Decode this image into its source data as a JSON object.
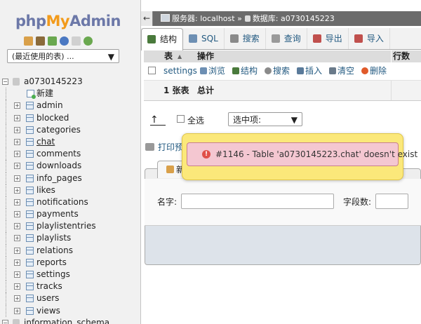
{
  "app": {
    "logo_php": "php",
    "logo_my": "My",
    "logo_admin": "Admin"
  },
  "left_panel": {
    "recent_select": "(最近使用的表) ...",
    "icons": [
      "home-icon",
      "exit-icon",
      "sql-query-icon",
      "help-icon",
      "docs-icon",
      "settings-icon"
    ],
    "database": "a0730145223",
    "new_item": "新建",
    "tables": [
      "admin",
      "blocked",
      "categories",
      "chat",
      "comments",
      "downloads",
      "info_pages",
      "likes",
      "notifications",
      "payments",
      "playlistentries",
      "playlists",
      "relations",
      "reports",
      "settings",
      "tracks",
      "users",
      "views"
    ],
    "next_database": "information_schema"
  },
  "breadcrumb": {
    "back": "←",
    "server": "服务器: localhost »",
    "database": "数据库: a0730145223"
  },
  "tabs": [
    {
      "label": "结构",
      "icon": "structure-icon",
      "color": "#4a7a3c"
    },
    {
      "label": "SQL",
      "icon": "sql-icon",
      "color": "#6d8fb3"
    },
    {
      "label": "搜索",
      "icon": "search-icon",
      "color": "#8a8a8a"
    },
    {
      "label": "查询",
      "icon": "query-icon",
      "color": "#9a9a9a"
    },
    {
      "label": "导出",
      "icon": "export-icon",
      "color": "#c0504d"
    },
    {
      "label": "导入",
      "icon": "import-icon",
      "color": "#c0504d"
    }
  ],
  "table_list": {
    "col_table": "表",
    "col_sort": "▲",
    "col_action": "操作",
    "col_rows": "行数",
    "row": {
      "name": "settings",
      "browse": "浏览",
      "structure": "结构",
      "search": "搜索",
      "insert": "插入",
      "empty": "清空",
      "drop": "删除"
    },
    "summary_count": "1 张表",
    "summary_total": "总计"
  },
  "with_selected": {
    "check_all": "全选",
    "select_placeholder": "选中项:"
  },
  "print": "打印预",
  "create_table": {
    "tab_label": "新",
    "name_label": "名字:",
    "fields_label": "字段数:"
  },
  "error": {
    "message": "#1146 - Table 'a0730145223.chat' doesn't exist",
    "icon": "error-icon",
    "color": "#e0504a"
  }
}
